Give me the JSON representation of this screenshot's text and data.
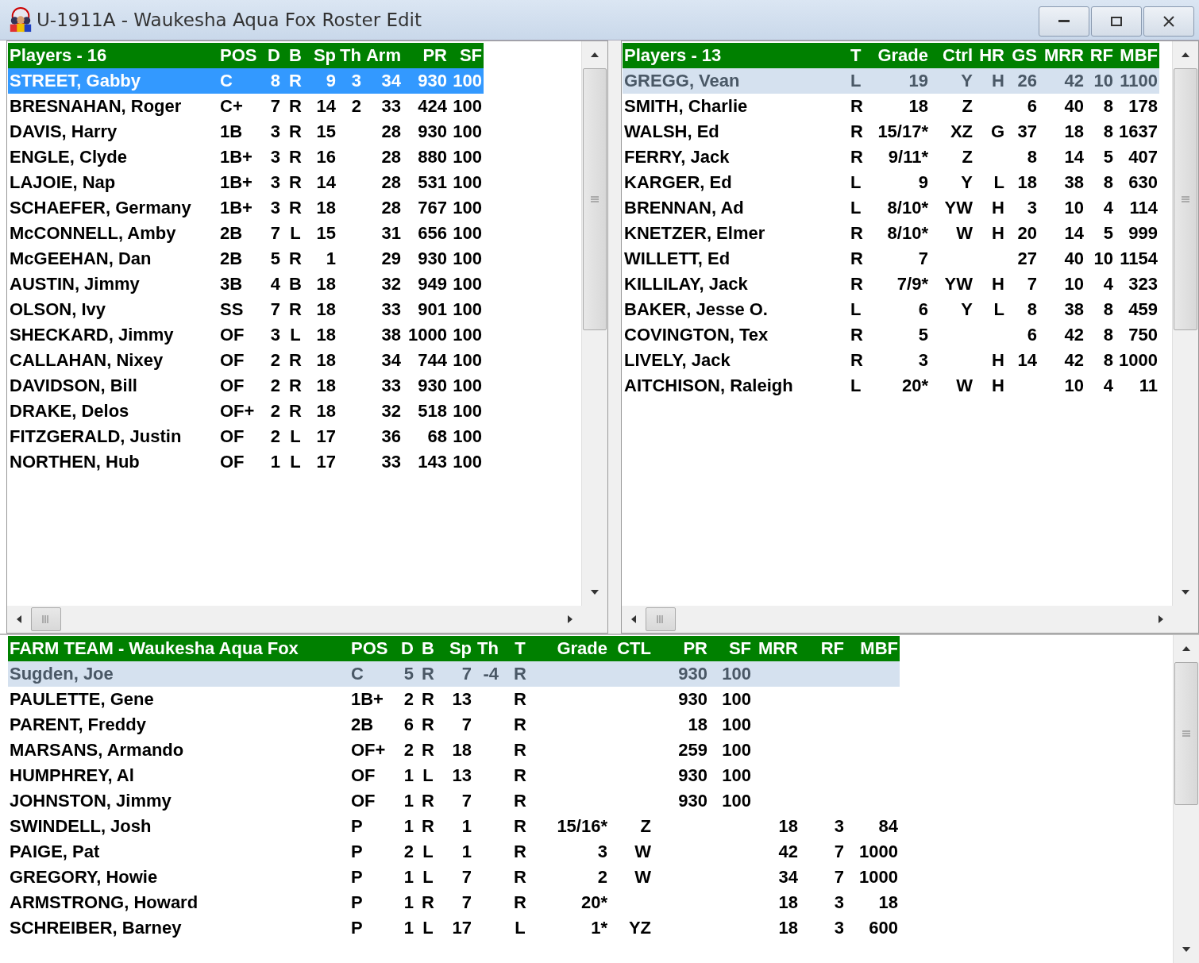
{
  "window": {
    "title": "U-1911A - Waukesha Aqua Fox Roster Edit"
  },
  "top_panes": [
    {
      "active": true,
      "columns": [
        "Players - 16",
        "POS",
        "D",
        "B",
        "Sp",
        "Th",
        "Arm",
        "PR",
        "SF"
      ],
      "rows": [
        {
          "selected": true,
          "cells": [
            "STREET, Gabby",
            "C",
            "8",
            "R",
            "9",
            "3",
            "34",
            "930",
            "100"
          ]
        },
        {
          "selected": false,
          "cells": [
            "BRESNAHAN, Roger",
            "C+",
            "7",
            "R",
            "14",
            "2",
            "33",
            "424",
            "100"
          ]
        },
        {
          "selected": false,
          "cells": [
            "DAVIS, Harry",
            "1B",
            "3",
            "R",
            "15",
            null,
            "28",
            "930",
            "100"
          ]
        },
        {
          "selected": false,
          "cells": [
            "ENGLE, Clyde",
            "1B+",
            "3",
            "R",
            "16",
            null,
            "28",
            "880",
            "100"
          ]
        },
        {
          "selected": false,
          "cells": [
            "LAJOIE, Nap",
            "1B+",
            "3",
            "R",
            "14",
            null,
            "28",
            "531",
            "100"
          ]
        },
        {
          "selected": false,
          "cells": [
            "SCHAEFER, Germany",
            "1B+",
            "3",
            "R",
            "18",
            null,
            "28",
            "767",
            "100"
          ]
        },
        {
          "selected": false,
          "cells": [
            "McCONNELL, Amby",
            "2B",
            "7",
            "L",
            "15",
            null,
            "31",
            "656",
            "100"
          ]
        },
        {
          "selected": false,
          "cells": [
            "McGEEHAN, Dan",
            "2B",
            "5",
            "R",
            "1",
            null,
            "29",
            "930",
            "100"
          ]
        },
        {
          "selected": false,
          "cells": [
            "AUSTIN, Jimmy",
            "3B",
            "4",
            "B",
            "18",
            null,
            "32",
            "949",
            "100"
          ]
        },
        {
          "selected": false,
          "cells": [
            "OLSON, Ivy",
            "SS",
            "7",
            "R",
            "18",
            null,
            "33",
            "901",
            "100"
          ]
        },
        {
          "selected": false,
          "cells": [
            "SHECKARD, Jimmy",
            "OF",
            "3",
            "L",
            "18",
            null,
            "38",
            "1000",
            "100"
          ]
        },
        {
          "selected": false,
          "cells": [
            "CALLAHAN, Nixey",
            "OF",
            "2",
            "R",
            "18",
            null,
            "34",
            "744",
            "100"
          ]
        },
        {
          "selected": false,
          "cells": [
            "DAVIDSON, Bill",
            "OF",
            "2",
            "R",
            "18",
            null,
            "33",
            "930",
            "100"
          ]
        },
        {
          "selected": false,
          "cells": [
            "DRAKE, Delos",
            "OF+",
            "2",
            "R",
            "18",
            null,
            "32",
            "518",
            "100"
          ]
        },
        {
          "selected": false,
          "cells": [
            "FITZGERALD, Justin",
            "OF",
            "2",
            "L",
            "17",
            null,
            "36",
            "68",
            "100"
          ]
        },
        {
          "selected": false,
          "cells": [
            "NORTHEN, Hub",
            "OF",
            "1",
            "L",
            "17",
            null,
            "33",
            "143",
            "100"
          ]
        }
      ]
    },
    {
      "active": false,
      "columns": [
        "Players - 13",
        "T",
        "Grade",
        "Ctrl",
        "HR",
        "GS",
        "MRR",
        "RF",
        "MBF"
      ],
      "rows": [
        {
          "selected": true,
          "cells": [
            "GREGG, Vean",
            "L",
            "19",
            "Y",
            "H",
            "26",
            "42",
            "10",
            "1100"
          ]
        },
        {
          "selected": false,
          "cells": [
            "SMITH, Charlie",
            "R",
            "18",
            "Z",
            null,
            "6",
            "40",
            "8",
            "178"
          ]
        },
        {
          "selected": false,
          "cells": [
            "WALSH, Ed",
            "R",
            "15/17*",
            "XZ",
            "G",
            "37",
            "18",
            "8",
            "1637"
          ]
        },
        {
          "selected": false,
          "cells": [
            "FERRY, Jack",
            "R",
            "9/11*",
            "Z",
            null,
            "8",
            "14",
            "5",
            "407"
          ]
        },
        {
          "selected": false,
          "cells": [
            "KARGER, Ed",
            "L",
            "9",
            "Y",
            "L",
            "18",
            "38",
            "8",
            "630"
          ]
        },
        {
          "selected": false,
          "cells": [
            "BRENNAN, Ad",
            "L",
            "8/10*",
            "YW",
            "H",
            "3",
            "10",
            "4",
            "114"
          ]
        },
        {
          "selected": false,
          "cells": [
            "KNETZER, Elmer",
            "R",
            "8/10*",
            "W",
            "H",
            "20",
            "14",
            "5",
            "999"
          ]
        },
        {
          "selected": false,
          "cells": [
            "WILLETT, Ed",
            "R",
            "7",
            null,
            null,
            "27",
            "40",
            "10",
            "1154"
          ]
        },
        {
          "selected": false,
          "cells": [
            "KILLILAY, Jack",
            "R",
            "7/9*",
            "YW",
            "H",
            "7",
            "10",
            "4",
            "323"
          ]
        },
        {
          "selected": false,
          "cells": [
            "BAKER, Jesse O.",
            "L",
            "6",
            "Y",
            "L",
            "8",
            "38",
            "8",
            "459"
          ]
        },
        {
          "selected": false,
          "cells": [
            "COVINGTON, Tex",
            "R",
            "5",
            null,
            null,
            "6",
            "42",
            "8",
            "750"
          ]
        },
        {
          "selected": false,
          "cells": [
            "LIVELY, Jack",
            "R",
            "3",
            null,
            "H",
            "14",
            "42",
            "8",
            "1000"
          ]
        },
        {
          "selected": false,
          "cells": [
            "AITCHISON, Raleigh",
            "L",
            "20*",
            "W",
            "H",
            null,
            "10",
            "4",
            "11"
          ]
        }
      ]
    }
  ],
  "farm_pane": {
    "active": false,
    "columns": [
      "FARM TEAM - Waukesha Aqua Fox",
      "POS",
      "D",
      "B",
      "Sp",
      "Th",
      "T",
      "Grade",
      "CTL",
      "PR",
      "SF",
      "MRR",
      "RF",
      "MBF"
    ],
    "rows": [
      {
        "selected": true,
        "cells": [
          "Sugden, Joe",
          "C",
          "5",
          "R",
          "7",
          "-4",
          "R",
          null,
          null,
          "930",
          "100",
          null,
          null,
          null
        ]
      },
      {
        "selected": false,
        "cells": [
          "PAULETTE, Gene",
          "1B+",
          "2",
          "R",
          "13",
          null,
          "R",
          null,
          null,
          "930",
          "100",
          null,
          null,
          null
        ]
      },
      {
        "selected": false,
        "cells": [
          "PARENT, Freddy",
          "2B",
          "6",
          "R",
          "7",
          null,
          "R",
          null,
          null,
          "18",
          "100",
          null,
          null,
          null
        ]
      },
      {
        "selected": false,
        "cells": [
          "MARSANS, Armando",
          "OF+",
          "2",
          "R",
          "18",
          null,
          "R",
          null,
          null,
          "259",
          "100",
          null,
          null,
          null
        ]
      },
      {
        "selected": false,
        "cells": [
          "HUMPHREY, Al",
          "OF",
          "1",
          "L",
          "13",
          null,
          "R",
          null,
          null,
          "930",
          "100",
          null,
          null,
          null
        ]
      },
      {
        "selected": false,
        "cells": [
          "JOHNSTON, Jimmy",
          "OF",
          "1",
          "R",
          "7",
          null,
          "R",
          null,
          null,
          "930",
          "100",
          null,
          null,
          null
        ]
      },
      {
        "selected": false,
        "cells": [
          "SWINDELL, Josh",
          "P",
          "1",
          "R",
          "1",
          null,
          "R",
          "15/16*",
          "Z",
          null,
          null,
          "18",
          "3",
          "84"
        ]
      },
      {
        "selected": false,
        "cells": [
          "PAIGE, Pat",
          "P",
          "2",
          "L",
          "1",
          null,
          "R",
          "3",
          "W",
          null,
          null,
          "42",
          "7",
          "1000"
        ]
      },
      {
        "selected": false,
        "cells": [
          "GREGORY, Howie",
          "P",
          "1",
          "L",
          "7",
          null,
          "R",
          "2",
          "W",
          null,
          null,
          "34",
          "7",
          "1000"
        ]
      },
      {
        "selected": false,
        "cells": [
          "ARMSTRONG, Howard",
          "P",
          "1",
          "R",
          "7",
          null,
          "R",
          "20*",
          null,
          null,
          null,
          "18",
          "3",
          "18"
        ]
      },
      {
        "selected": false,
        "cells": [
          "SCHREIBER, Barney",
          "P",
          "1",
          "L",
          "17",
          null,
          "L",
          "1*",
          "YZ",
          null,
          null,
          "18",
          "3",
          "600"
        ]
      }
    ]
  }
}
